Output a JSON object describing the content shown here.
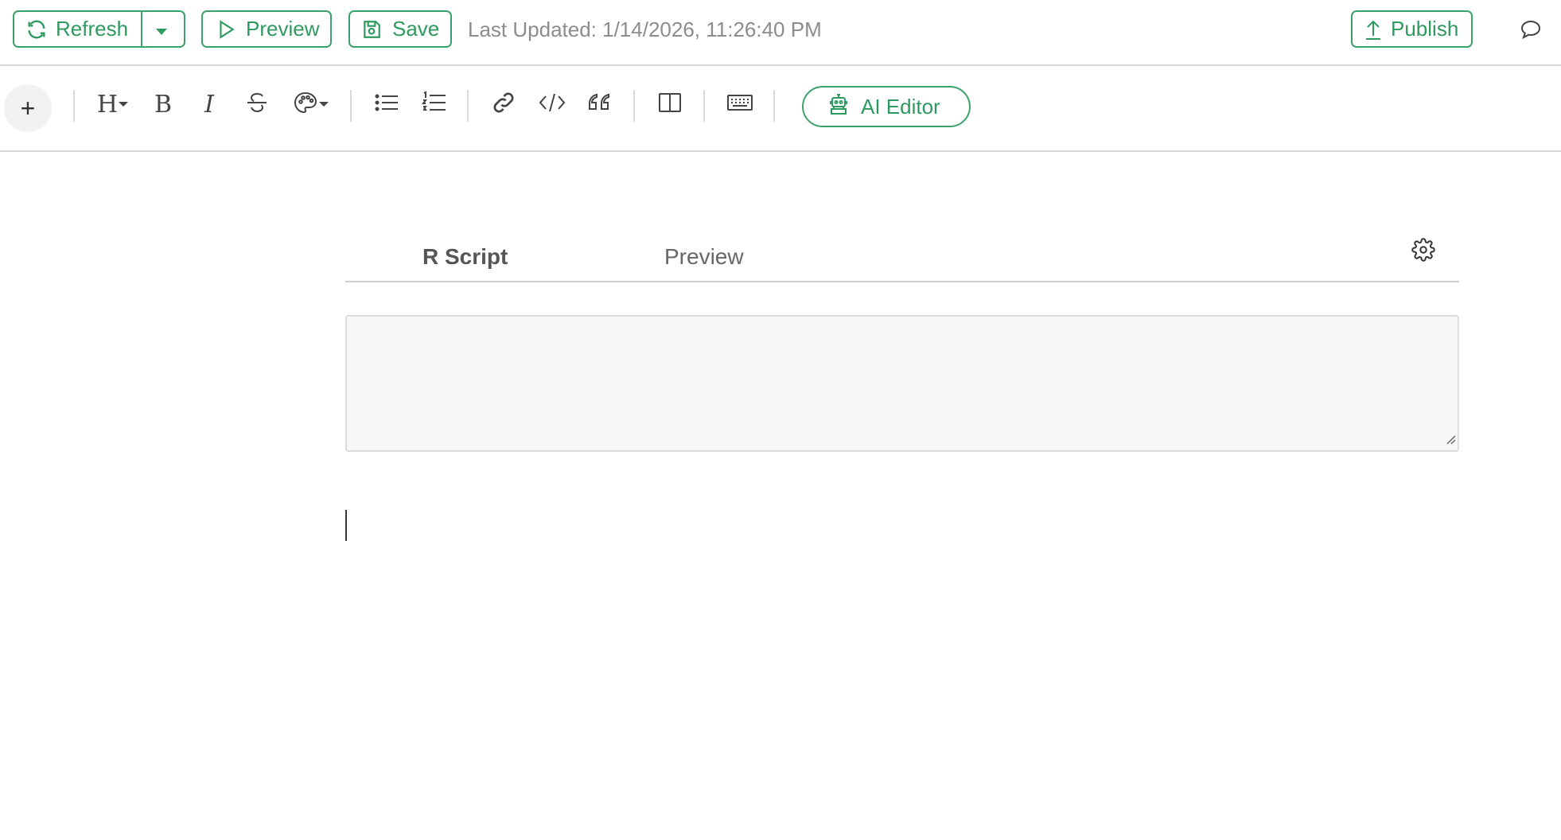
{
  "header": {
    "refresh_label": "Refresh",
    "preview_label": "Preview",
    "save_label": "Save",
    "last_updated": "Last Updated: 1/14/2026, 11:26:40 PM",
    "publish_label": "Publish"
  },
  "toolbar": {
    "plus_label": "+",
    "heading_label": "H",
    "bold_label": "B",
    "italic_label": "I",
    "ai_editor_label": "AI Editor",
    "icons": [
      "plus-icon",
      "heading-icon",
      "bold-icon",
      "italic-icon",
      "strikethrough-icon",
      "palette-icon",
      "bullet-list-icon",
      "numbered-list-icon",
      "link-icon",
      "code-icon",
      "quote-icon",
      "columns-icon",
      "keyboard-icon",
      "robot-icon"
    ]
  },
  "editor": {
    "tabs": [
      {
        "label": "R Script",
        "active": true
      },
      {
        "label": "Preview",
        "active": false
      }
    ],
    "code_value": ""
  },
  "colors": {
    "accent": "#2f9a5f",
    "border": "#d9d9d9",
    "code_bg": "#f7f7f7"
  }
}
